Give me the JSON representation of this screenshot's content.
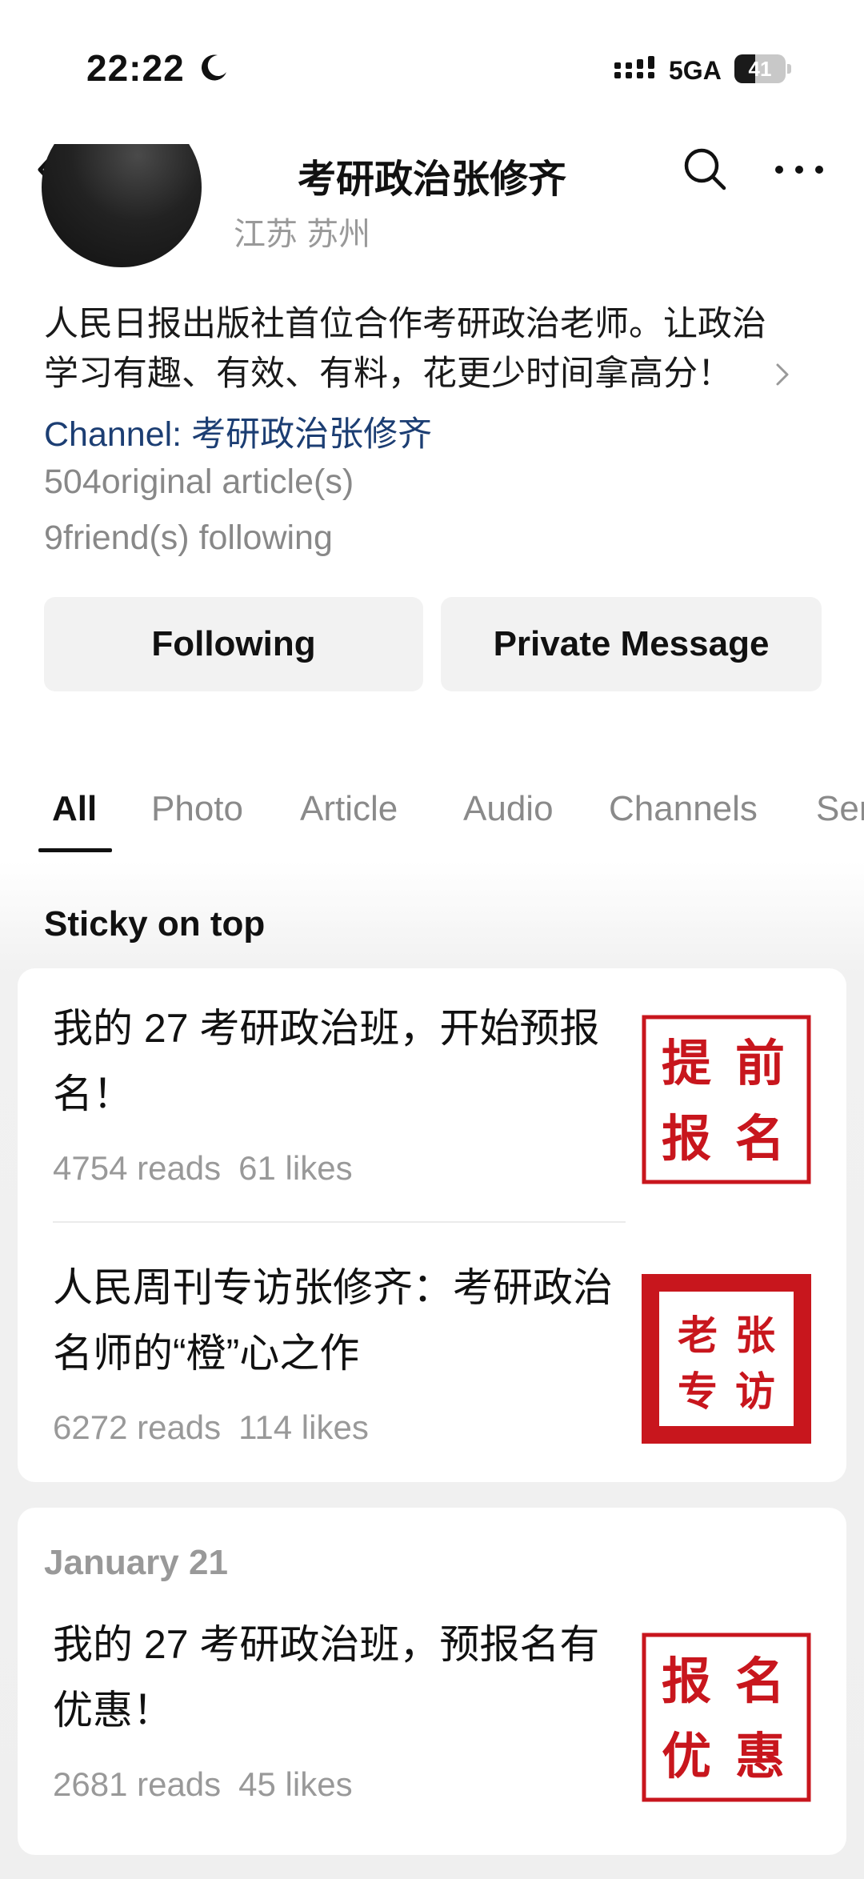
{
  "status": {
    "time": "22:22",
    "network": "5GA",
    "battery": "41",
    "battery_level": 0.41
  },
  "nav": {
    "title": "考研政治张修齐"
  },
  "profile": {
    "location": "江苏 苏州",
    "bio_line1": "人民日报出版社首位合作考研政治老师。让政治",
    "bio_line2": "学习有趣、有效、有料，花更少时间拿高分！",
    "channel_label": "Channel: 考研政治张修齐",
    "original_articles": "504original article(s)",
    "friends_following": "9friend(s) following",
    "follow_button": "Following",
    "message_button": "Private Message"
  },
  "tabs": [
    "All",
    "Photo",
    "Article",
    "Audio",
    "Channels",
    "Series"
  ],
  "sticky": {
    "title": "Sticky on top",
    "articles": [
      {
        "title": "我的 27 考研政治班，开始预报名！",
        "reads": "4754 reads",
        "likes": "61 likes",
        "thumb_text": [
          "提",
          "前",
          "报",
          "名"
        ]
      },
      {
        "title": "人民周刊专访张修齐：考研政治名师的“橙”心之作",
        "reads": "6272 reads",
        "likes": "114 likes",
        "thumb_text": [
          "老",
          "张",
          "专",
          "访"
        ]
      }
    ]
  },
  "dated": {
    "date": "January 21",
    "articles": [
      {
        "title": "我的 27 考研政治班，预报名有优惠！",
        "reads": "2681 reads",
        "likes": "45 likes",
        "thumb_text": [
          "报",
          "名",
          "优",
          "惠"
        ]
      }
    ]
  },
  "colors": {
    "accent_red": "#c8161d",
    "channel_blue": "#1c3e73"
  }
}
